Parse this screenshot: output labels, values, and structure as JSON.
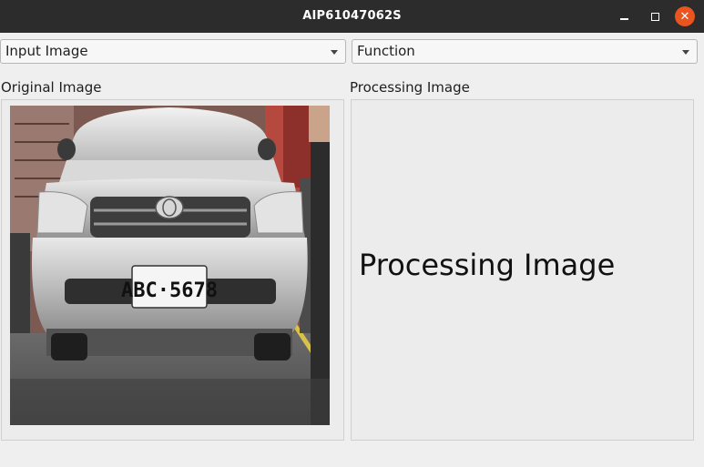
{
  "window": {
    "title": "AIP61047062S",
    "controls": [
      "minimize-icon",
      "maximize-icon",
      "close-icon"
    ],
    "close_color": "#e9541f"
  },
  "toolbar": {
    "input_combo": {
      "selected": "Input Image"
    },
    "function_combo": {
      "selected": "Function"
    }
  },
  "panels": {
    "original": {
      "label": "Original Image",
      "plate_text": "ABC-5678"
    },
    "processing": {
      "label": "Processing Image",
      "placeholder_text": "Processing Image"
    }
  }
}
